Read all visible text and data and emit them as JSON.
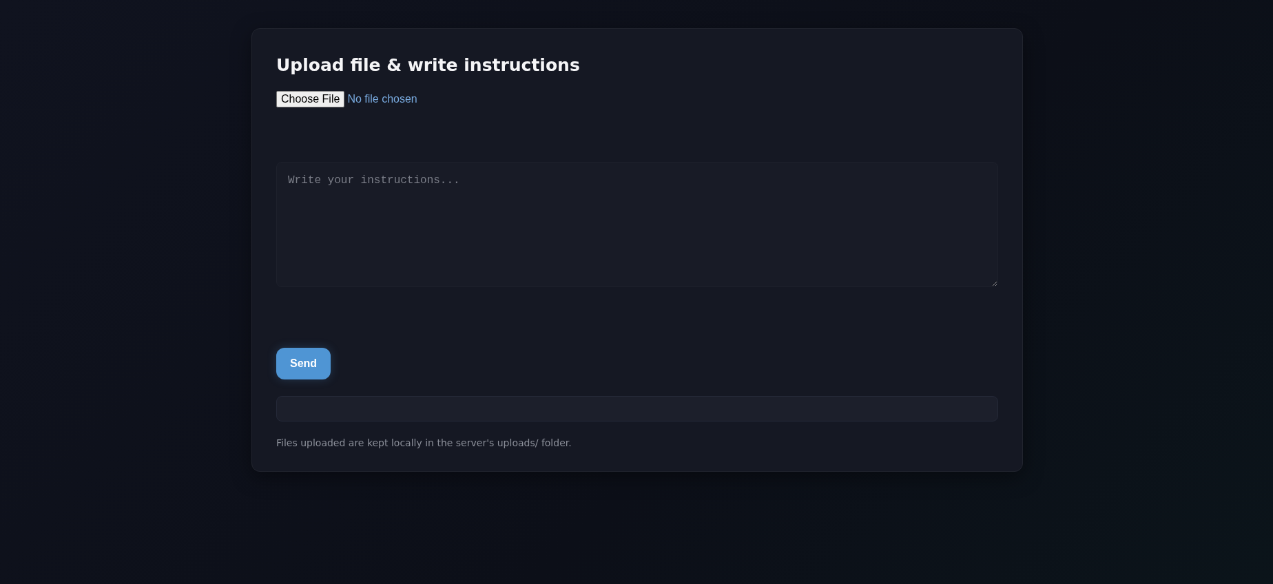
{
  "card": {
    "title": "Upload file & write instructions",
    "file_input": {
      "button_label": "Choose File",
      "status": "No file chosen"
    },
    "instructions": {
      "placeholder": "Write your instructions..."
    },
    "send_button": {
      "label": "Send"
    },
    "note": "Files uploaded are kept locally in the server's uploads/ folder."
  }
}
